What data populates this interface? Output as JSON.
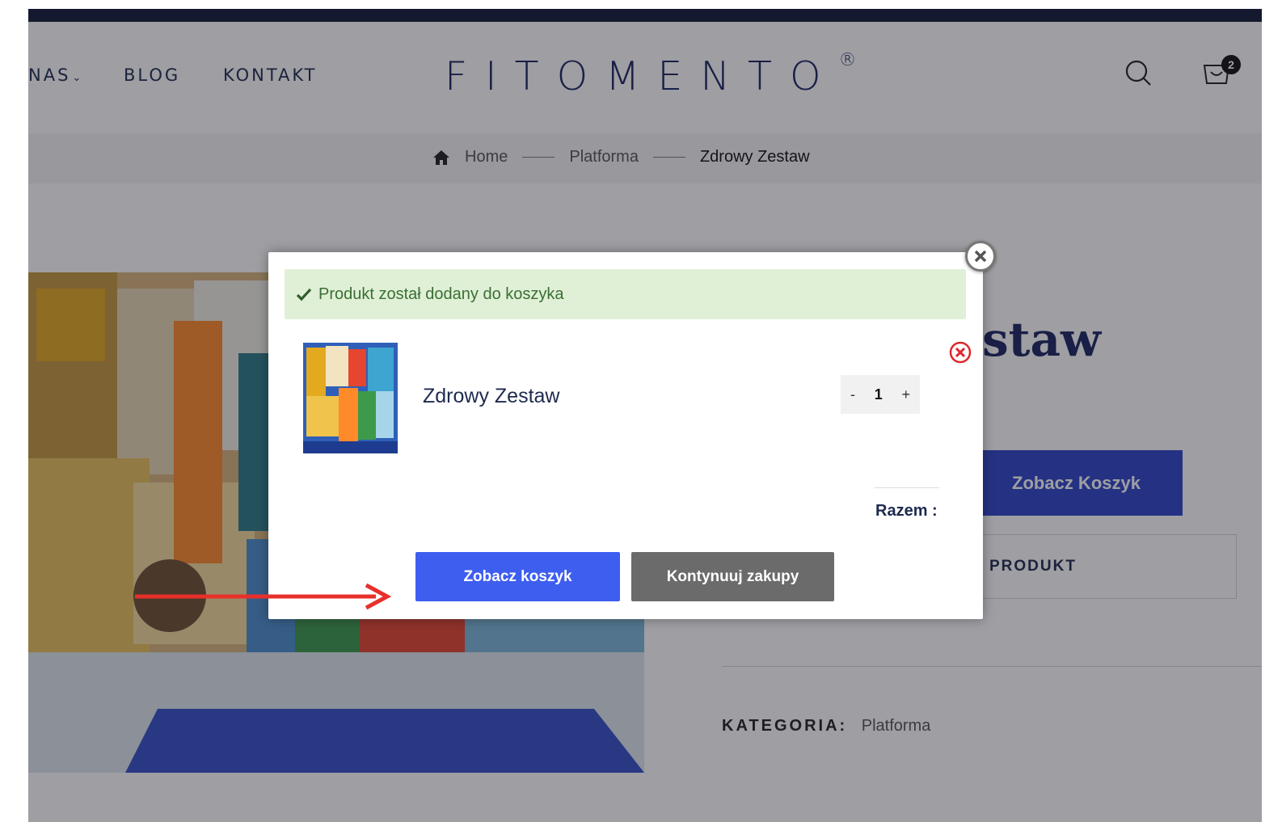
{
  "header": {
    "nav_items": [
      {
        "label": "NAS"
      },
      {
        "label": "BLOG"
      },
      {
        "label": "KONTAKT"
      }
    ],
    "logo": "FITOMENTO",
    "logo_mark": "®",
    "cart_count": "2"
  },
  "breadcrumb": {
    "items": [
      "Home",
      "Platforma",
      "Zdrowy Zestaw"
    ]
  },
  "product": {
    "title_visible": "staw",
    "view_cart_label": "Zobacz Koszyk",
    "tab_label": "PRODUKT",
    "category_label": "KATEGORIA:",
    "category_value": "Platforma"
  },
  "modal": {
    "alert_text": "Produkt został dodany do koszyka",
    "item_name": "Zdrowy Zestaw",
    "qty_minus": "-",
    "qty_value": "1",
    "qty_plus": "+",
    "total_label": "Razem :",
    "view_cart_button": "Zobacz koszyk",
    "continue_button": "Kontynuuj zakupy"
  },
  "colors": {
    "brand_navy": "#1b2560",
    "primary_button": "#3e5ef0",
    "secondary_button": "#6b6b6b",
    "success_bg": "#dff0d6",
    "annotation_arrow": "#e8302b"
  },
  "icons": [
    "search-icon",
    "cart-icon",
    "home-icon",
    "check-icon",
    "remove-icon",
    "close-icon",
    "arrow-annotation"
  ]
}
